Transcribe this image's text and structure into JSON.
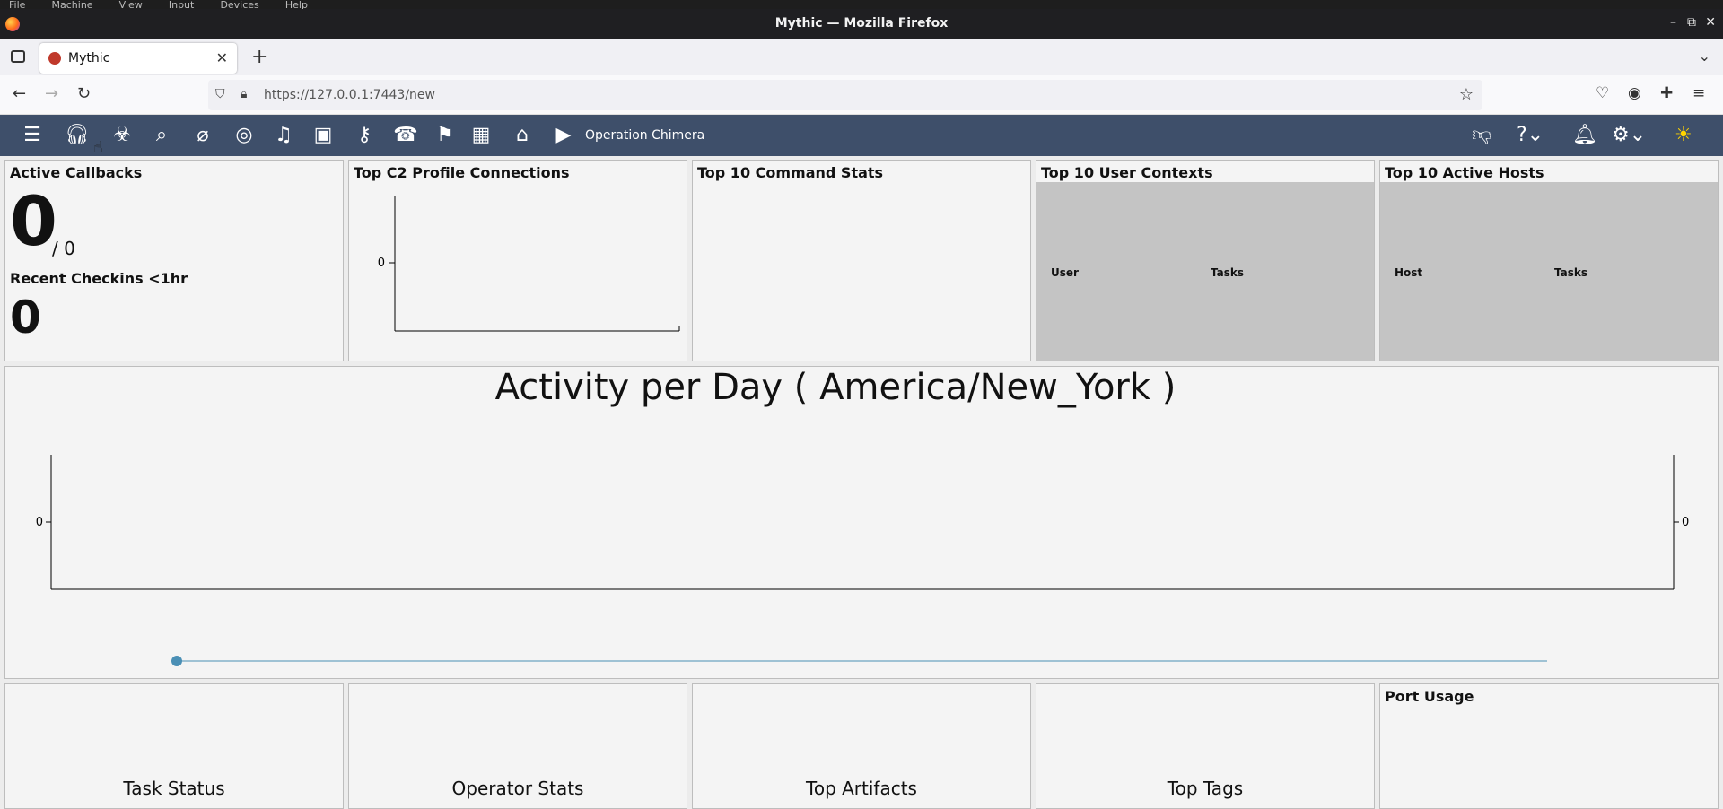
{
  "vm_menu": [
    "File",
    "Machine",
    "View",
    "Input",
    "Devices",
    "Help"
  ],
  "window": {
    "title": "Mythic — Mozilla Firefox"
  },
  "tabs": [
    {
      "label": "Mythic"
    }
  ],
  "address": {
    "url": "https://127.0.0.1:7443/new"
  },
  "appbar": {
    "operation": "Operation Chimera"
  },
  "dashboard": {
    "active_callbacks": {
      "title": "Active Callbacks",
      "value": "0",
      "total": "/ 0"
    },
    "recent_checkins": {
      "title": "Recent Checkins <1hr",
      "value": "0"
    },
    "c2_profiles": {
      "title": "Top C2 Profile Connections",
      "y_tick": "0"
    },
    "command_stats": {
      "title": "Top 10 Command Stats"
    },
    "user_contexts": {
      "title": "Top 10 User Contexts",
      "col_user": "User",
      "col_tasks": "Tasks"
    },
    "active_hosts": {
      "title": "Top 10 Active Hosts",
      "col_host": "Host",
      "col_tasks": "Tasks"
    },
    "activity": {
      "title": "Activity per Day ( America/New_York )",
      "y_left_tick": "0",
      "y_right_tick": "0"
    },
    "bottom": {
      "task_status": "Task Status",
      "operator_stats": "Operator Stats",
      "top_artifacts": "Top Artifacts",
      "top_tags": "Top Tags",
      "port_usage": "Port Usage"
    }
  },
  "colors": {
    "appbar": "#3e4f6a",
    "slider": "#4a8fb5",
    "panel_gray": "#c4c4c4"
  },
  "icons": [
    "hamburger-icon",
    "headphones-icon",
    "biohazard-icon",
    "search-icon",
    "paperclip-icon",
    "fingerprint-icon",
    "socks-icon",
    "camera-icon",
    "key-icon",
    "phone-icon",
    "flag-checkered-icon",
    "table-icon",
    "tag-icon",
    "play-circle-icon",
    "thumbs-down-icon",
    "help-icon",
    "bell-icon",
    "user-settings-icon",
    "sun-icon"
  ]
}
